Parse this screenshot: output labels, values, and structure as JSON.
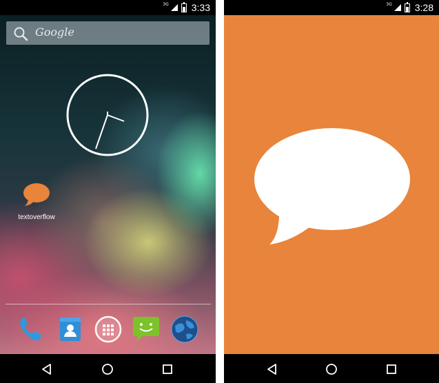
{
  "left_screen": {
    "status": {
      "network": "3G",
      "time": "3:33"
    },
    "search": {
      "label": "Google"
    },
    "clock_widget": {
      "hour_hand": "3",
      "minute_hand": "33"
    },
    "app": {
      "label": "textoverflow"
    },
    "dock": [
      "phone-icon",
      "contacts-icon",
      "app-drawer-icon",
      "messaging-icon",
      "browser-icon"
    ],
    "nav": [
      "back",
      "home",
      "recents"
    ]
  },
  "right_screen": {
    "status": {
      "network": "3G",
      "time": "3:28"
    },
    "background_color": "#E8843B",
    "splash_icon": "speech-bubble-icon",
    "nav": [
      "back",
      "home",
      "recents"
    ]
  }
}
